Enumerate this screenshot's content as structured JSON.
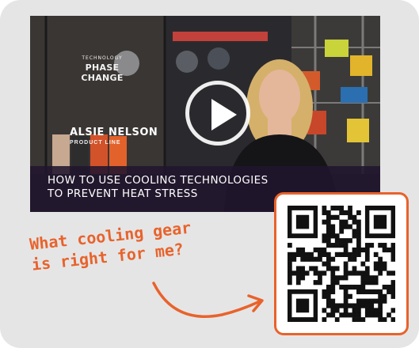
{
  "video": {
    "title_line1": "HOW TO USE COOLING TECHNOLOGIES",
    "title_line2": "TO PREVENT HEAT STRESS",
    "presenter_name": "ALSIE NELSON",
    "presenter_role": "PRODUCT LINE",
    "sign_small": "TECHNOLOGY",
    "sign_big": "PHASE CHANGE",
    "play_icon": "play-icon"
  },
  "callout": {
    "line1": "What cooling gear",
    "line2": "is right for me?"
  },
  "qr": {
    "icon": "qr-code-icon"
  },
  "colors": {
    "accent": "#e8632b",
    "card": "#e5e5e6",
    "title_bar": "#21162e"
  }
}
